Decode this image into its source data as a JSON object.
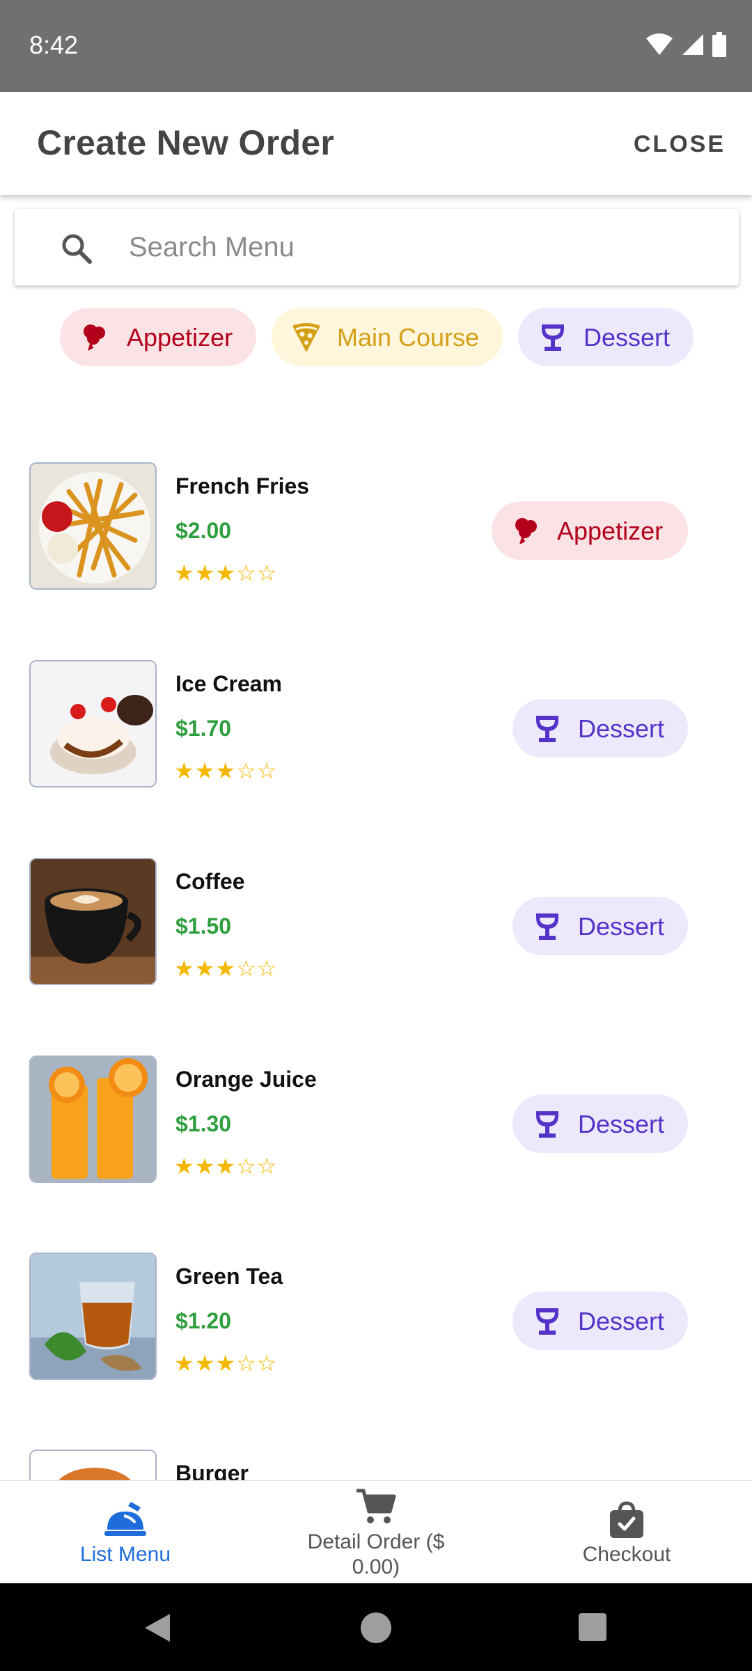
{
  "status_bar": {
    "time": "8:42",
    "icons": [
      "wifi-icon",
      "signal-icon",
      "battery-icon"
    ]
  },
  "app_bar": {
    "title": "Create New Order",
    "close_label": "CLOSE"
  },
  "search": {
    "placeholder": "Search Menu",
    "value": ""
  },
  "filters": [
    {
      "label": "Appetizer",
      "icon": "appetizer-icon"
    },
    {
      "label": "Main Course",
      "icon": "pizza-icon"
    },
    {
      "label": "Dessert",
      "icon": "dessert-icon"
    }
  ],
  "menu_items": [
    {
      "name": "French Fries",
      "price": "$2.00",
      "stars": "★★★☆☆",
      "rating": 3,
      "category": "Appetizer"
    },
    {
      "name": "Ice Cream",
      "price": "$1.70",
      "stars": "★★★☆☆",
      "rating": 3,
      "category": "Dessert"
    },
    {
      "name": "Coffee",
      "price": "$1.50",
      "stars": "★★★☆☆",
      "rating": 3,
      "category": "Dessert"
    },
    {
      "name": "Orange Juice",
      "price": "$1.30",
      "stars": "★★★☆☆",
      "rating": 3,
      "category": "Dessert"
    },
    {
      "name": "Green Tea",
      "price": "$1.20",
      "stars": "★★★☆☆",
      "rating": 3,
      "category": "Dessert"
    },
    {
      "name": "Burger",
      "price": "",
      "stars": "",
      "rating": null,
      "category": ""
    }
  ],
  "bottom_nav": [
    {
      "label": "List Menu",
      "icon": "list-menu-icon",
      "active": true
    },
    {
      "label": "Detail Order ($",
      "label_line2": "0.00)",
      "icon": "cart-icon",
      "active": false
    },
    {
      "label": "Checkout",
      "icon": "checkout-bag-icon",
      "active": false
    }
  ],
  "colors": {
    "appetizer": "#b3001b",
    "main_course": "#d4a017",
    "dessert": "#5533c8",
    "price_green": "#2e9e3e",
    "star": "#f5b800",
    "nav_active": "#1e6ddb"
  }
}
